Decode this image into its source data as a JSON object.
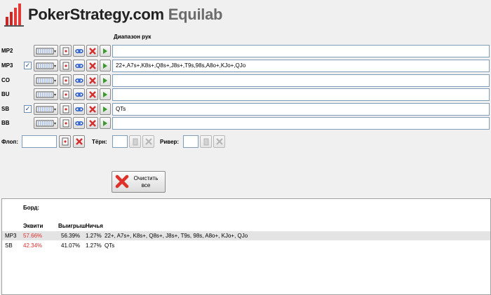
{
  "app": {
    "brand": "PokerStrategy.com",
    "product": "Equilab"
  },
  "hand_range_header": "Диапазон рук",
  "players": [
    {
      "name": "MP2",
      "checked": false,
      "range": ""
    },
    {
      "name": "MP3",
      "checked": true,
      "range": "22+,A7s+,K8s+,Q8s+,J8s+,T9s,98s,A8o+,KJo+,QJo"
    },
    {
      "name": "CO",
      "checked": false,
      "range": ""
    },
    {
      "name": "BU",
      "checked": false,
      "range": ""
    },
    {
      "name": "SB",
      "checked": true,
      "range": "QTs"
    },
    {
      "name": "BB",
      "checked": false,
      "range": ""
    }
  ],
  "board_inputs": {
    "flop_label": "Флоп:",
    "turn_label": "Тёрн:",
    "river_label": "Ривер:"
  },
  "clear_button": {
    "line1": "Очистить",
    "line2": "все"
  },
  "results": {
    "board_label": "Борд:",
    "columns": {
      "equity": "Эквити",
      "win": "Выигрыш",
      "tie": "Ничья"
    },
    "rows": [
      {
        "player": "MP3",
        "equity": "57.66%",
        "win": "56.39%",
        "tie": "1.27%",
        "range": "22+, A7s+, K8s+, Q8s+, J8s+, T9s, 98s, A8o+, KJo+, QJo"
      },
      {
        "player": "SB",
        "equity": "42.34%",
        "win": "41.07%",
        "tie": "1.27%",
        "range": "QTs"
      }
    ]
  },
  "colors": {
    "equity_text": "#e03030",
    "selected_row": "#e4e4e4"
  }
}
